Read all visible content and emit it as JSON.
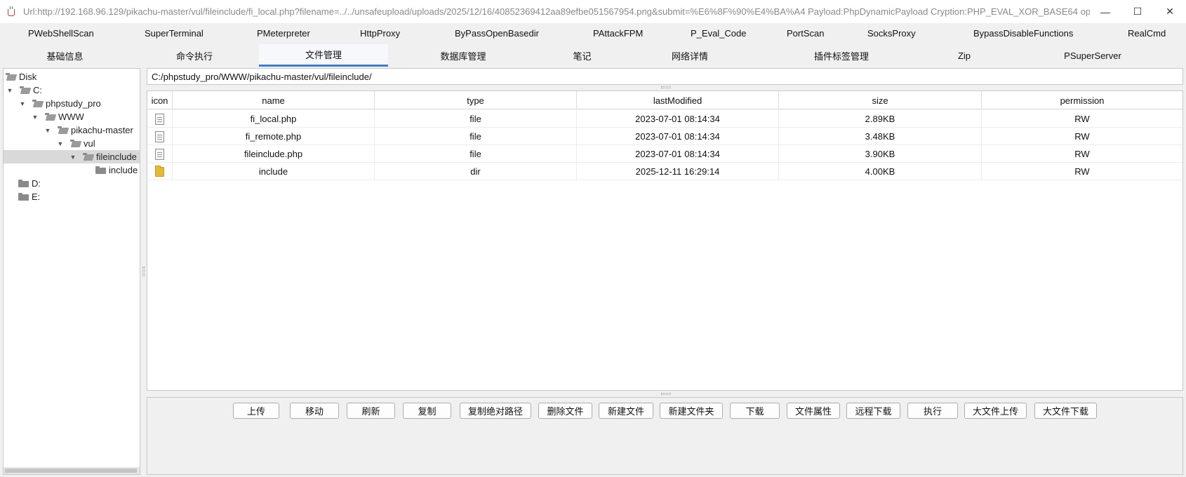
{
  "window": {
    "title": "Url:http://192.168.96.129/pikachu-master/vul/fileinclude/fi_local.php?filename=../../unsafeupload/uploads/2025/12/16/40852369412aa89efbe051567954.png&submit=%E6%8F%90%E4%BA%A4 Payload:PhpDynamicPayload Cryption:PHP_EVAL_XOR_BASE64 ope...",
    "minimize": "—",
    "maximize": "☐",
    "close": "✕"
  },
  "plugins": [
    "PWebShellScan",
    "SuperTerminal",
    "PMeterpreter",
    "HttpProxy",
    "ByPassOpenBasedir",
    "PAttackFPM",
    "P_Eval_Code",
    "PortScan",
    "SocksProxy",
    "BypassDisableFunctions",
    "RealCmd"
  ],
  "tabs": [
    "基础信息",
    "命令执行",
    "文件管理",
    "数据库管理",
    "笔记",
    "网络详情",
    "插件标签管理",
    "Zip",
    "PSuperServer"
  ],
  "active_tab": "文件管理",
  "tree": [
    {
      "label": "Disk",
      "level": 0,
      "toggle": "",
      "open": true
    },
    {
      "label": "C:",
      "level": 1,
      "toggle": "▼",
      "open": true
    },
    {
      "label": "phpstudy_pro",
      "level": 2,
      "toggle": "▼",
      "open": true
    },
    {
      "label": "WWW",
      "level": 3,
      "toggle": "▼",
      "open": true
    },
    {
      "label": "pikachu-master",
      "level": 4,
      "toggle": "▼",
      "open": true
    },
    {
      "label": "vul",
      "level": 5,
      "toggle": "▼",
      "open": true
    },
    {
      "label": "fileinclude",
      "level": 6,
      "toggle": "▼",
      "open": true,
      "selected": true
    },
    {
      "label": "include",
      "level": 7,
      "toggle": "",
      "open": false
    },
    {
      "label": "D:",
      "level": 1,
      "toggle": "",
      "open": false
    },
    {
      "label": "E:",
      "level": 1,
      "toggle": "",
      "open": false
    }
  ],
  "path": "C:/phpstudy_pro/WWW/pikachu-master/vul/fileinclude/",
  "table": {
    "headers": [
      "icon",
      "name",
      "type",
      "lastModified",
      "size",
      "permission"
    ],
    "rows": [
      {
        "icon": "file-icon",
        "name": "fi_local.php",
        "type": "file",
        "lastModified": "2023-07-01 08:14:34",
        "size": "2.89KB",
        "permission": "RW"
      },
      {
        "icon": "file-icon",
        "name": "fi_remote.php",
        "type": "file",
        "lastModified": "2023-07-01 08:14:34",
        "size": "3.48KB",
        "permission": "RW"
      },
      {
        "icon": "file-icon",
        "name": "fileinclude.php",
        "type": "file",
        "lastModified": "2023-07-01 08:14:34",
        "size": "3.90KB",
        "permission": "RW"
      },
      {
        "icon": "folder-icon",
        "name": "include",
        "type": "dir",
        "lastModified": "2025-12-11 16:29:14",
        "size": "4.00KB",
        "permission": "RW"
      }
    ]
  },
  "actions": [
    "上传",
    "移动",
    "刷新",
    "复制",
    "复制绝对路径",
    "删除文件",
    "新建文件",
    "新建文件夹",
    "下载",
    "文件属性",
    "远程下载",
    "执行",
    "大文件上传",
    "大文件下载"
  ]
}
